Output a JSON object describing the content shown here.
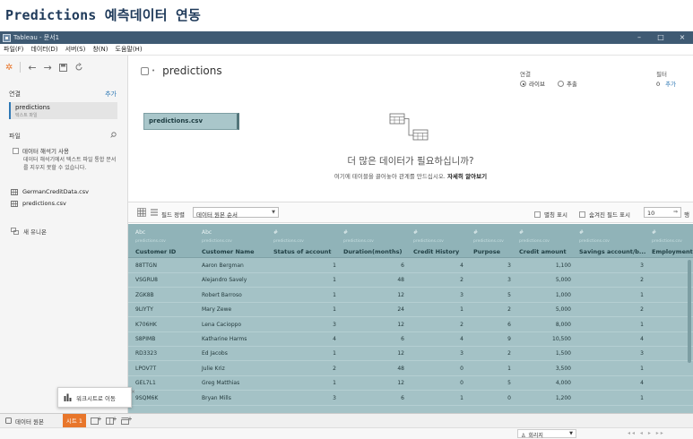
{
  "heading": "Predictions 예측데이터 연동",
  "window": {
    "title": "Tableau - 문서1",
    "controls": [
      "–",
      "□",
      "×"
    ]
  },
  "menu": [
    "파일(F)",
    "데이터(D)",
    "서버(S)",
    "창(N)",
    "도움말(H)"
  ],
  "left_pane": {
    "connections_label": "연결",
    "add_label": "추가",
    "connection": {
      "name": "predictions",
      "type": "텍스트 파일"
    },
    "files_label": "파일",
    "interpreter_label": "데이터 해석기 사용",
    "interpreter_help": "데이터 해석기에서 텍스트 파일 통합 문서를 지우지 못할 수 있습니다.",
    "files": [
      "GermanCreditData.csv",
      "predictions.csv"
    ],
    "new_union": "새 유니온"
  },
  "canvas": {
    "datasource_name": "predictions",
    "connection_label": "연결",
    "live_label": "라이브",
    "extract_label": "추출",
    "filter_label": "필터",
    "filter_count": "0",
    "filter_add": "추가",
    "table_pill": "predictions.csv",
    "more_data_title": "더 많은 데이터가 필요하십니까?",
    "more_data_sub": "여기에 테이블을 끌어놓아 관계를 만드십시오.",
    "more_data_link": "자세히 알아보기"
  },
  "gridbar": {
    "sort_label": "필드 정렬",
    "sort_value": "데이터 원본 순서",
    "show_alias": "별칭 표시",
    "show_hidden": "숨겨진 필드 표시",
    "rows_value": "10",
    "rows_arrow": "⇒",
    "rows_label": "행"
  },
  "grid": {
    "columns": [
      {
        "type": "Abc",
        "source": "predictions.csv",
        "name": "Customer ID"
      },
      {
        "type": "Abc",
        "source": "predictions.csv",
        "name": "Customer Name"
      },
      {
        "type": "#",
        "source": "predictions.csv",
        "name": "Status of account"
      },
      {
        "type": "#",
        "source": "predictions.csv",
        "name": "Duration(months)"
      },
      {
        "type": "#",
        "source": "predictions.csv",
        "name": "Credit History"
      },
      {
        "type": "#",
        "source": "predictions.csv",
        "name": "Purpose"
      },
      {
        "type": "#",
        "source": "predictions.csv",
        "name": "Credit amount"
      },
      {
        "type": "#",
        "source": "predictions.csv",
        "name": "Savings account/b..."
      },
      {
        "type": "#",
        "source": "predictions.csv",
        "name": "Employment"
      }
    ],
    "rows": [
      [
        "88TTGN",
        "Aaron Bergman",
        "1",
        "6",
        "4",
        "3",
        "1,100",
        "3",
        ""
      ],
      [
        "VSGRU8",
        "Alejandro Savely",
        "1",
        "48",
        "2",
        "3",
        "5,000",
        "2",
        ""
      ],
      [
        "ZGK8B",
        "Robert Barroso",
        "1",
        "12",
        "3",
        "5",
        "1,000",
        "1",
        ""
      ],
      [
        "9LIYTY",
        "Mary Zewe",
        "1",
        "24",
        "1",
        "2",
        "5,000",
        "2",
        ""
      ],
      [
        "K706HK",
        "Lena Cacioppo",
        "3",
        "12",
        "2",
        "6",
        "8,000",
        "1",
        ""
      ],
      [
        "S8PIMB",
        "Katharine Harms",
        "4",
        "6",
        "4",
        "9",
        "10,500",
        "4",
        ""
      ],
      [
        "RD3323",
        "Ed Jacobs",
        "1",
        "12",
        "3",
        "2",
        "1,500",
        "3",
        ""
      ],
      [
        "LPOV7T",
        "Julie Kriz",
        "2",
        "48",
        "0",
        "1",
        "3,500",
        "1",
        ""
      ],
      [
        "GEL7L1",
        "Greg Matthias",
        "1",
        "12",
        "0",
        "5",
        "4,000",
        "4",
        ""
      ],
      [
        "9SQM6K",
        "Bryan Mills",
        "3",
        "6",
        "1",
        "0",
        "1,200",
        "1",
        ""
      ]
    ]
  },
  "tooltip": {
    "text": "워크시트로 이동",
    "close": "×"
  },
  "tabs": {
    "source_tab": "데이터 원본",
    "sheet_tab": "시트 1"
  },
  "status": {
    "user": "회리지",
    "pager": "◂◂ ◂ ▸ ▸▸"
  },
  "colors": {
    "accent_orange": "#e8762b",
    "grid_body": "#a4c2c6",
    "grid_header": "#90b3b8",
    "titlebar": "#3f5a73",
    "link_blue": "#2f79b5"
  }
}
